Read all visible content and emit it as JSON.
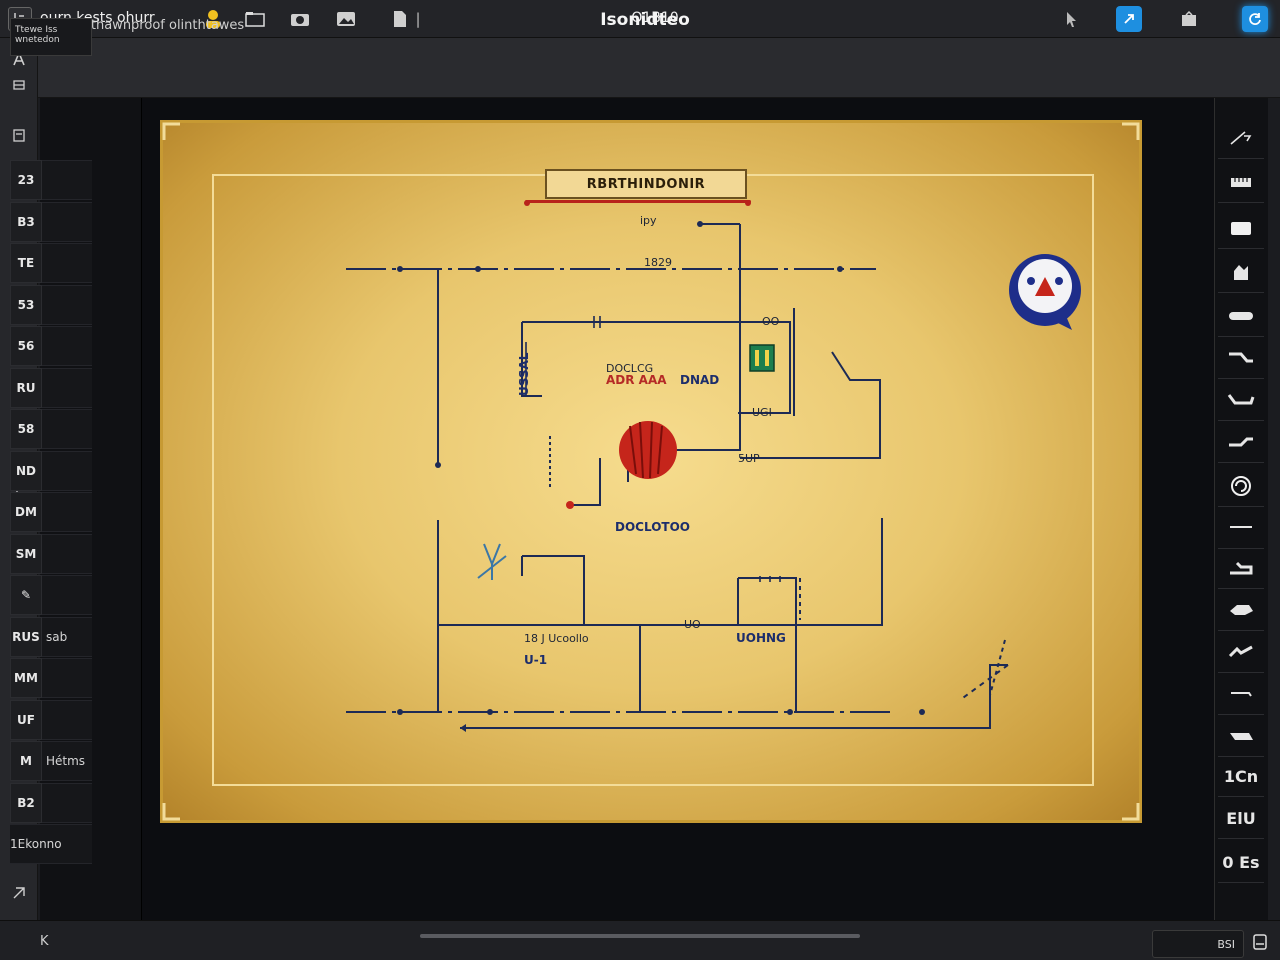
{
  "app": {
    "title": "ourn kests ohurr",
    "center_title": "O1B10"
  },
  "subbar": {
    "breadcrumb": "Bsouthawnproof olinthtawes",
    "doc_title": "Isonidteo"
  },
  "colors": {
    "accent": "#1e8fe0",
    "gold": "#c79a33",
    "wire": "#1d2a55",
    "red": "#c5251b"
  },
  "left_panel": {
    "header": "Ttewe Iss wnetedon",
    "rows": [
      {
        "code": "23",
        "side": ""
      },
      {
        "code": "B3",
        "side": ""
      },
      {
        "code": "TE",
        "side": ""
      },
      {
        "code": "53",
        "side": ""
      },
      {
        "code": "56",
        "side": ""
      },
      {
        "code": "RU",
        "side": ""
      },
      {
        "code": "58",
        "side": ""
      },
      {
        "code": "ND",
        "side": ""
      },
      {
        "code": "DM",
        "side": ""
      },
      {
        "code": "SM",
        "side": ""
      },
      {
        "code": "✎",
        "side": ""
      },
      {
        "code": "RUS",
        "side": "sab"
      },
      {
        "code": "MM",
        "side": ""
      },
      {
        "code": "UF",
        "side": ""
      },
      {
        "code": "M",
        "side": "Hétms"
      },
      {
        "code": "B2",
        "side": ""
      },
      {
        "code": "",
        "side": "1Ekonno"
      }
    ]
  },
  "schematic": {
    "title": "RBRTHINDONIR",
    "labels": {
      "top_small": "ipy",
      "r1": "1829",
      "c1": "OO",
      "mid_a": "DOCLCG",
      "mid_b": "ADR AAA",
      "mid_c": "DNAD",
      "u1": "UGI",
      "node": "5UP",
      "core": "DOCLOTOO",
      "lower_a": "18 J Ucoollo",
      "lower_b": "UO",
      "lower_c": "UOHNG",
      "lower_d": "U-1",
      "left_v": "USSAL"
    }
  },
  "right_tools": {
    "labels": {
      "t1": "1Cn",
      "t2": "ElU",
      "t3": "0 Es"
    }
  },
  "bottom": {
    "tool_label": "BSI",
    "left_glyph": "K"
  }
}
